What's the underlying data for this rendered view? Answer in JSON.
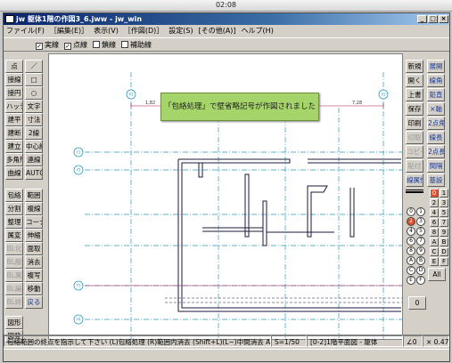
{
  "os_bar": {
    "time": "02:08"
  },
  "window": {
    "title": "jw 躯体1階の作図3_6.jww - jw_win",
    "minimize": "_",
    "maximize": "□",
    "close": "×"
  },
  "menu": [
    "ファイル(F)",
    "［編集(E)］",
    "表示(V)",
    "［作図(D)］",
    "設定(S)",
    "[その他(A)]",
    "ヘルプ(H)"
  ],
  "options": [
    {
      "label": "実線",
      "checked": true
    },
    {
      "label": "点線",
      "checked": true
    },
    {
      "label": "鎖線",
      "checked": false
    },
    {
      "label": "補助線",
      "checked": false
    }
  ],
  "left_tools": [
    [
      "点",
      "／"
    ],
    [
      "接線",
      "□"
    ],
    [
      "接円",
      "○"
    ],
    [
      "ハッチ",
      "文字"
    ],
    [
      "建平",
      "寸法"
    ],
    [
      "建断",
      "2線"
    ],
    [
      "建立",
      "中心線"
    ],
    [
      "多角形",
      "連線"
    ],
    [
      "曲線",
      "AUTO"
    ],
    [
      "包絡",
      "範囲"
    ],
    [
      "分割",
      "複線"
    ],
    [
      "整理",
      "コーナー"
    ],
    [
      "属変",
      "伸縮"
    ],
    [
      "BL化",
      "面取"
    ],
    [
      "BL解",
      "消去"
    ],
    [
      "BL属",
      "複写"
    ],
    [
      "BL編",
      "移動"
    ],
    [
      "BL終",
      "戻る"
    ],
    [
      "図形",
      ""
    ],
    [
      "図登",
      ""
    ]
  ],
  "right_tools": [
    [
      "新規",
      "展開"
    ],
    [
      "開く",
      "線角"
    ],
    [
      "上書",
      "鉛直"
    ],
    [
      "保存",
      "×軸"
    ],
    [
      "印刷",
      "2点角"
    ],
    [
      "切取",
      "線長"
    ],
    [
      "コピー",
      "2点長"
    ],
    [
      "貼付",
      "間隔"
    ],
    [
      "線属性",
      "基設"
    ]
  ],
  "layer_numbers": [
    "0",
    "1",
    "2",
    "3",
    "4",
    "5",
    "6",
    "7",
    "8",
    "9",
    "A",
    "B",
    "C",
    "D",
    "E",
    "F"
  ],
  "layer_group_labels": {
    "all": "All",
    "zero": "0"
  },
  "toast": "「包絡処理」で壁省略記号が作図されました",
  "canvas": {
    "grid_labels": [
      "X1",
      "X2",
      "Y1",
      "Y2",
      "Y3",
      "Y4"
    ],
    "dim_text": "1,82",
    "dim_text2": "7,28"
  },
  "status": {
    "message": "包絡範囲の終点を指示して下さい (L)包絡処理 (R)範囲内消去 (Shift+L)(L~)中間消去 A-2",
    "scale": "S=1/50",
    "layer": "[0-2]1階平面図 - 躯体",
    "angle": "∠0",
    "zoom": "× 0.47"
  },
  "colors": {
    "toast_bg": "#a5d46a",
    "grid_line": "#2a9ab8",
    "wall": "#1a1a3a",
    "dim_line": "#b01050"
  }
}
